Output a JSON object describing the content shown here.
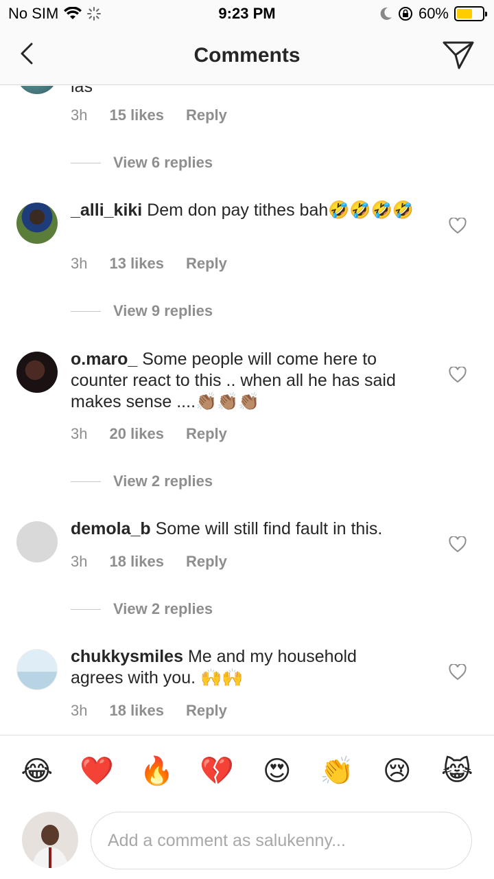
{
  "status_bar": {
    "carrier": "No SIM",
    "time": "9:23 PM",
    "battery_percent": "60%",
    "battery_level": 0.6,
    "battery_color": "#ffcc00"
  },
  "nav": {
    "title": "Comments",
    "back_icon": "chevron-left-icon",
    "send_icon": "paper-plane-icon"
  },
  "partial_comment": {
    "text_fragment": "las",
    "time": "3h",
    "likes": "15 likes",
    "reply_label": "Reply",
    "view_replies": "View 6 replies"
  },
  "comments": [
    {
      "username": "_alli_kiki",
      "text": " Dem don pay tithes bah🤣🤣🤣🤣",
      "time": "3h",
      "likes": "13 likes",
      "reply_label": "Reply",
      "view_replies": "View 9 replies"
    },
    {
      "username": "o.maro_",
      "text": " Some people will come here to counter react to this .. when all he has said makes sense ....👏🏽👏🏽👏🏽",
      "time": "3h",
      "likes": "20 likes",
      "reply_label": "Reply",
      "view_replies": "View 2 replies"
    },
    {
      "username": "demola_b",
      "text": " Some will still find fault in this.",
      "time": "3h",
      "likes": "18 likes",
      "reply_label": "Reply",
      "view_replies": "View 2 replies"
    },
    {
      "username": "chukkysmiles",
      "text": " Me and my household agrees with you. 🙌🙌",
      "time": "3h",
      "likes": "18 likes",
      "reply_label": "Reply"
    }
  ],
  "emoji_bar": [
    "😂",
    "❤️",
    "🔥",
    "💔",
    "😍",
    "👏",
    "😢",
    "😹"
  ],
  "composer": {
    "placeholder": "Add a comment as salukenny..."
  }
}
